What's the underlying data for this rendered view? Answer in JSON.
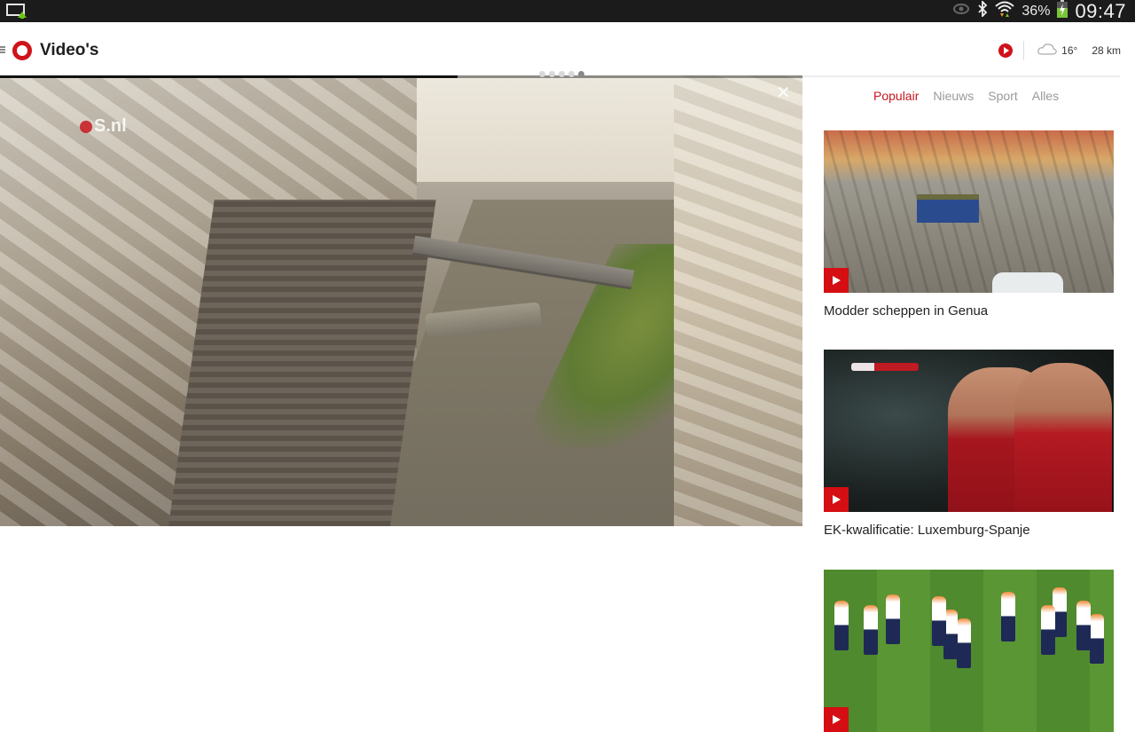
{
  "status_bar": {
    "left_icon": "screen-mirror-icon",
    "icons": [
      "eye-icon",
      "bluetooth-icon",
      "wifi-icon"
    ],
    "battery_percent": "36%",
    "battery_icon": "battery-charging-icon",
    "time": "09:47"
  },
  "app_bar": {
    "menu_icon": "menu-handle-icon",
    "logo_icon": "nos-logo-icon",
    "title": "Video's",
    "play_icon": "play-circle-icon",
    "weather_icon": "cloud-icon",
    "temperature": "16°",
    "distance": "28 km"
  },
  "player": {
    "watermark": "S.nl",
    "close_icon": "close-icon",
    "progress_fraction": 0.57,
    "pager": {
      "count": 5,
      "active_index": 4
    },
    "accent_color": "#d0131b"
  },
  "sidebar": {
    "tabs": [
      {
        "label": "Populair",
        "active": true
      },
      {
        "label": "Nieuws",
        "active": false
      },
      {
        "label": "Sport",
        "active": false
      },
      {
        "label": "Alles",
        "active": false
      }
    ],
    "videos": [
      {
        "title": "Modder scheppen in Genua",
        "badge_icon": "play-icon"
      },
      {
        "title": "EK-kwalificatie: Luxemburg-Spanje",
        "badge_icon": "play-icon",
        "scorebug": "LUX 0-0 ESP"
      },
      {
        "title": "",
        "badge_icon": "play-icon"
      }
    ]
  },
  "colors": {
    "brand_red": "#d0131b",
    "tab_active": "#c8161e",
    "tab_inactive": "#9a9a9a"
  }
}
